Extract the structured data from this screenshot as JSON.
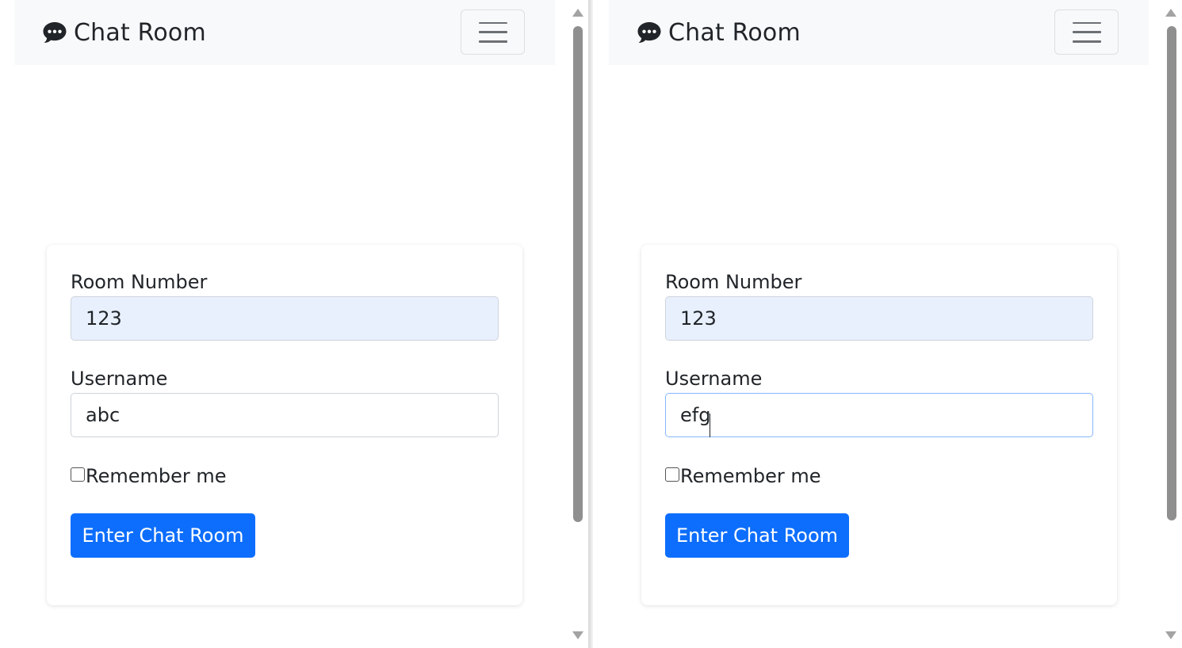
{
  "left_window": {
    "brand": {
      "icon": "comment-dots-icon",
      "title": "Chat Room"
    },
    "toggler_icon": "hamburger-menu-icon",
    "form": {
      "room_label": "Room Number",
      "room_value": "123",
      "username_label": "Username",
      "username_value": "abc",
      "remember_label": "Remember me",
      "remember_checked": false,
      "submit_label": "Enter Chat Room"
    }
  },
  "right_window": {
    "brand": {
      "icon": "comment-dots-icon",
      "title": "Chat Room"
    },
    "toggler_icon": "hamburger-menu-icon",
    "form": {
      "room_label": "Room Number",
      "room_value": "123",
      "username_label": "Username",
      "username_value": "efg",
      "username_focused": true,
      "remember_label": "Remember me",
      "remember_checked": false,
      "submit_label": "Enter Chat Room"
    }
  },
  "colors": {
    "primary": "#0d6efd",
    "navbar_bg": "#f8f9fa",
    "autofill_bg": "#e8f0fe",
    "focus_border": "#86b7fe",
    "text": "#212529"
  }
}
